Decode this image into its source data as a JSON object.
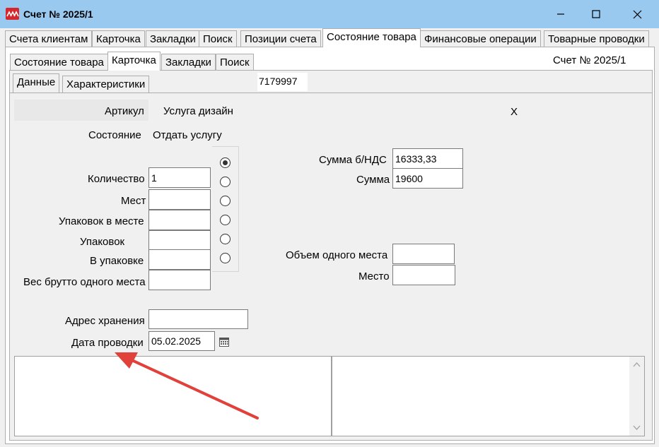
{
  "window": {
    "title": "Счет № 2025/1"
  },
  "top_tabs": [
    {
      "label": "Счета клиентам"
    },
    {
      "label": "Карточка"
    },
    {
      "label": "Закладки"
    },
    {
      "label": "Поиск"
    },
    {
      "label": "Позиции счета"
    },
    {
      "label": "Состояние товара"
    },
    {
      "label": "Финансовые операции"
    },
    {
      "label": "Товарные проводки"
    }
  ],
  "sub_tabs": [
    {
      "label": "Состояние товара"
    },
    {
      "label": "Карточка"
    },
    {
      "label": "Закладки"
    },
    {
      "label": "Поиск"
    }
  ],
  "inner_tabs": [
    {
      "label": "Данные"
    },
    {
      "label": "Характеристики"
    }
  ],
  "header": {
    "invoice_label": "Счет № 2025/1",
    "code": "7179997"
  },
  "form": {
    "article_label": "Артикул",
    "article_value": "Услуга дизайн",
    "article_x": "Х",
    "state_label": "Состояние",
    "state_value": "Отдать услугу",
    "qty_label": "Количество",
    "qty_value": "1",
    "places_label": "Мест",
    "places_value": "",
    "packs_in_place_label": "Упаковок в месте",
    "packs_in_place_value": "",
    "packs_label": "Упаковок",
    "packs_value": "",
    "in_pack_label": "В упаковке",
    "in_pack_value": "",
    "gross_weight_label": "Вес брутто одного места",
    "gross_weight_value": "",
    "sum_no_vat_label": "Сумма  б/НДС",
    "sum_no_vat_value": "16333,33",
    "sum_label": "Сумма",
    "sum_value": "19600",
    "volume_label": "Объем одного места",
    "volume_value": "",
    "place_label": "Место",
    "place_value": "",
    "storage_label": "Адрес хранения",
    "storage_value": "",
    "date_label": "Дата проводки",
    "date_value": "05.02.2025"
  },
  "radio_checked_index": 0,
  "colors": {
    "titlebar": "#99c9ef",
    "arrow": "#e0413b",
    "logo": "#d6262c"
  }
}
